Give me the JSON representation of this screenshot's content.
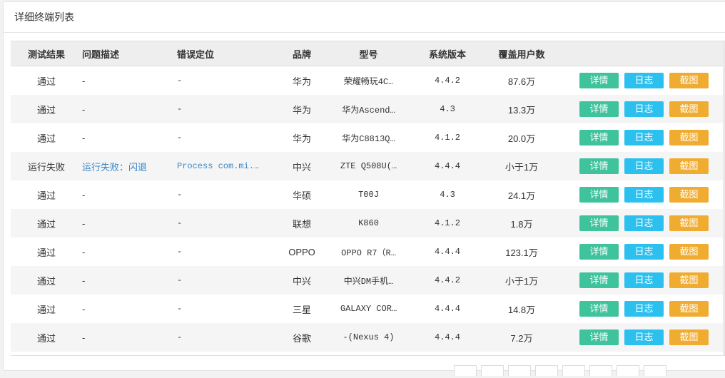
{
  "panel": {
    "title": "详细终端列表"
  },
  "table": {
    "headers": [
      "测试结果",
      "问题描述",
      "错误定位",
      "品牌",
      "型号",
      "系统版本",
      "覆盖用户数",
      ""
    ],
    "buttons": {
      "detail": "详情",
      "log": "日志",
      "shot": "截图"
    },
    "rows": [
      {
        "result": "通过",
        "desc": "-",
        "error": "-",
        "brand": "华为",
        "model": "荣耀畅玩4C…",
        "version": "4.4.2",
        "users": "87.6万"
      },
      {
        "result": "通过",
        "desc": "-",
        "error": "-",
        "brand": "华为",
        "model": "华为Ascend…",
        "version": "4.3",
        "users": "13.3万"
      },
      {
        "result": "通过",
        "desc": "-",
        "error": "-",
        "brand": "华为",
        "model": "华为C8813Q…",
        "version": "4.1.2",
        "users": "20.0万"
      },
      {
        "result": "运行失败",
        "desc": "运行失败：闪退",
        "error": "Process com.mi.…",
        "brand": "中兴",
        "model": "ZTE Q508U(…",
        "version": "4.4.4",
        "users": "小于1万"
      },
      {
        "result": "通过",
        "desc": "-",
        "error": "-",
        "brand": "华硕",
        "model": "T00J",
        "version": "4.3",
        "users": "24.1万"
      },
      {
        "result": "通过",
        "desc": "-",
        "error": "-",
        "brand": "联想",
        "model": "K860",
        "version": "4.1.2",
        "users": "1.8万"
      },
      {
        "result": "通过",
        "desc": "-",
        "error": "-",
        "brand": "OPPO",
        "model": "OPPO R7（R…",
        "version": "4.4.4",
        "users": "123.1万"
      },
      {
        "result": "通过",
        "desc": "-",
        "error": "-",
        "brand": "中兴",
        "model": "中兴DM手机…",
        "version": "4.4.2",
        "users": "小于1万"
      },
      {
        "result": "通过",
        "desc": "-",
        "error": "-",
        "brand": "三星",
        "model": "GALAXY COR…",
        "version": "4.4.4",
        "users": "14.8万"
      },
      {
        "result": "通过",
        "desc": "-",
        "error": "-",
        "brand": "谷歌",
        "model": "-(Nexus 4)",
        "version": "4.4.4",
        "users": "7.2万"
      }
    ]
  },
  "colors": {
    "detail": "#3ec39c",
    "log": "#2bc0ee",
    "shot": "#f0ac30",
    "link": "#3a87c8"
  }
}
